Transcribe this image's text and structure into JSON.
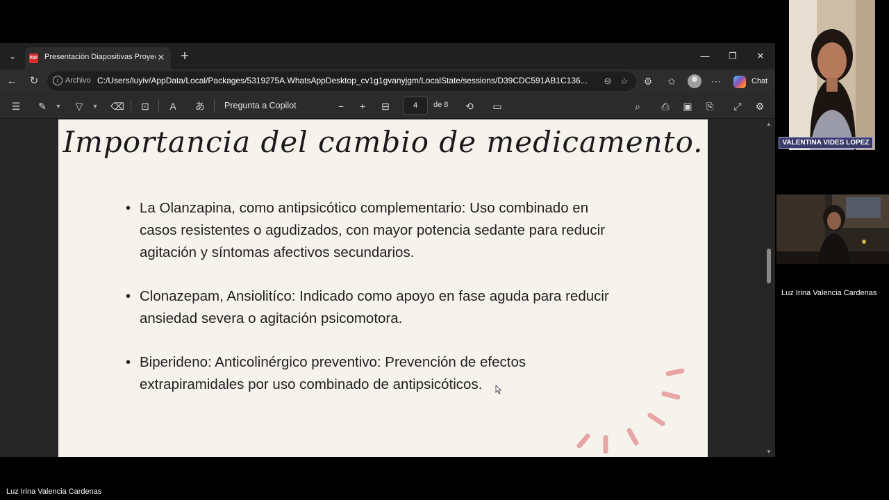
{
  "browser": {
    "tab": {
      "title": "Presentación Diapositivas Proyecto",
      "favicon": "PDF"
    },
    "new_tab_symbol": "+",
    "address": {
      "label": "Archivo",
      "url": "C:/Users/luyiv/AppData/Local/Packages/5319275A.WhatsAppDesktop_cv1g1gvanyjgm/LocalState/sessions/D39CDC591AB1C136..."
    },
    "chat_label": "Chat"
  },
  "pdf_toolbar": {
    "ask_copilot": "Pregunta a Copilot",
    "page_current": "4",
    "page_total_label": "de 8"
  },
  "slide": {
    "title": "Importancia del cambio de medicamento.",
    "bullets": [
      "La  Olanzapina, como antipsicótico complementario: Uso combinado en casos resistentes o agudizados, con mayor potencia sedante para reducir agitación y síntomas afectivos secundarios.",
      "Clonazepam, Ansiolitíco: Indicado como apoyo en fase aguda para reducir ansiedad severa o agitación psicomotora.",
      "Biperideno: Anticolinérgico preventivo: Prevención de efectos extrapiramidales por uso combinado de antipsicóticos."
    ],
    "decor_color": "#e8a5a5"
  },
  "participants": {
    "video1_name": "VALENTINA VIDES LOPEZ",
    "video2_name": "Luz Irina Valencia Cardenas",
    "presenter_name": "Luz Irina Valencia Cardenas"
  },
  "colors": {
    "slide_bg": "#f6f3ec",
    "viewer_bg": "#262626",
    "name_tag_bg": "#3b3b6b"
  }
}
